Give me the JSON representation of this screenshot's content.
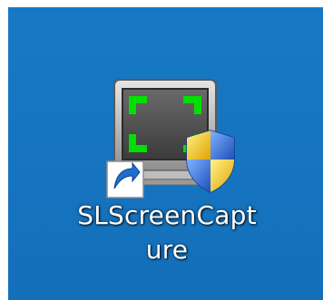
{
  "desktop": {
    "background_color": "#1776c2",
    "shortcut": {
      "name_line1": "SLScreenCapt",
      "name_line2": "ure",
      "icon": "screen-capture-monitor-icon",
      "overlay_icons": [
        "shortcut-arrow-icon",
        "uac-shield-icon"
      ],
      "accent_color": "#00e000"
    }
  }
}
